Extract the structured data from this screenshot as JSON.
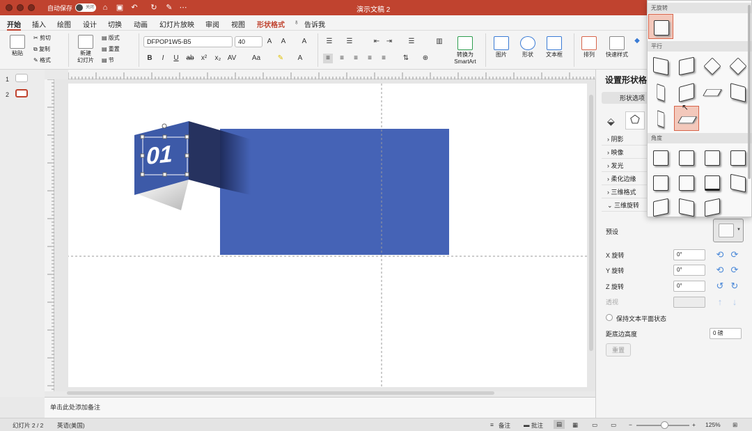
{
  "titlebar": {
    "autosave": "自动保存",
    "toggle": "关闭",
    "title": "演示文稿 2"
  },
  "menu": [
    "开始",
    "插入",
    "绘图",
    "设计",
    "切换",
    "动画",
    "幻灯片放映",
    "审阅",
    "视图",
    "形状格式",
    "告诉我"
  ],
  "ribbon": {
    "paste": "粘贴",
    "cut": "剪切",
    "copy": "复制",
    "format": "格式",
    "new_slide": "新建\n幻灯片",
    "layout": "版式",
    "reset": "重置",
    "section": "节",
    "font": "DFPOP1W5-B5",
    "size": "40",
    "smartart": "转换为\nSmartArt",
    "picture": "图片",
    "shape": "形状",
    "textbox": "文本框",
    "arrange": "排列",
    "quick_style": "快速样式"
  },
  "slide": {
    "textbox": "01"
  },
  "notes": "单击此处添加备注",
  "status": {
    "slide": "幻灯片 2 / 2",
    "lang": "英语(美国)",
    "notes": "备注",
    "comments": "批注",
    "zoom": "125%"
  },
  "thumbs": [
    "1",
    "2"
  ],
  "pane": {
    "title": "设置形状格式",
    "tab": "形状选项",
    "sections": [
      "阴影",
      "映像",
      "发光",
      "柔化边缘",
      "三维格式",
      "三维旋转"
    ],
    "preset": "预设",
    "x": "X 旋转",
    "y": "Y 旋转",
    "z": "Z 旋转",
    "persp": "透视",
    "xv": "0°",
    "yv": "0°",
    "zv": "0°",
    "keep": "保持文本平面状态",
    "dist": "距底边高度",
    "distv": "0 磅",
    "reset": "重置"
  },
  "gallery": {
    "h1": "无旋转",
    "h2": "平行",
    "h3": "角度"
  },
  "colors": {
    "accent": "#c0432f",
    "shape": "#4a63b4"
  }
}
